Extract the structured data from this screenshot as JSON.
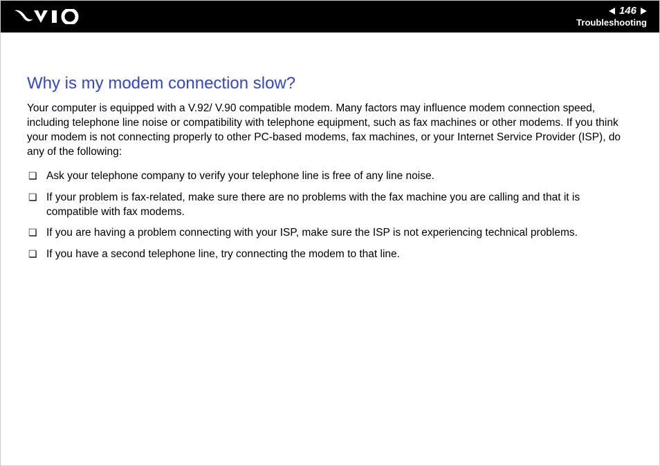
{
  "header": {
    "page_number": "146",
    "section": "Troubleshooting"
  },
  "page": {
    "heading": "Why is my modem connection slow?",
    "intro": "Your computer is equipped with a V.92/ V.90 compatible modem. Many factors may influence modem connection speed, including telephone line noise or compatibility with telephone equipment, such as fax machines or other modems. If you think your modem is not connecting properly to other PC-based modems, fax machines, or your Internet Service Provider (ISP), do any of the following:",
    "bullets": [
      "Ask your telephone company to verify your telephone line is free of any line noise.",
      "If your problem is fax-related, make sure there are no problems with the fax machine you are calling and that it is compatible with fax modems.",
      "If you are having a problem connecting with your ISP, make sure the ISP is not experiencing technical problems.",
      "If you have a second telephone line, try connecting the modem to that line."
    ]
  }
}
